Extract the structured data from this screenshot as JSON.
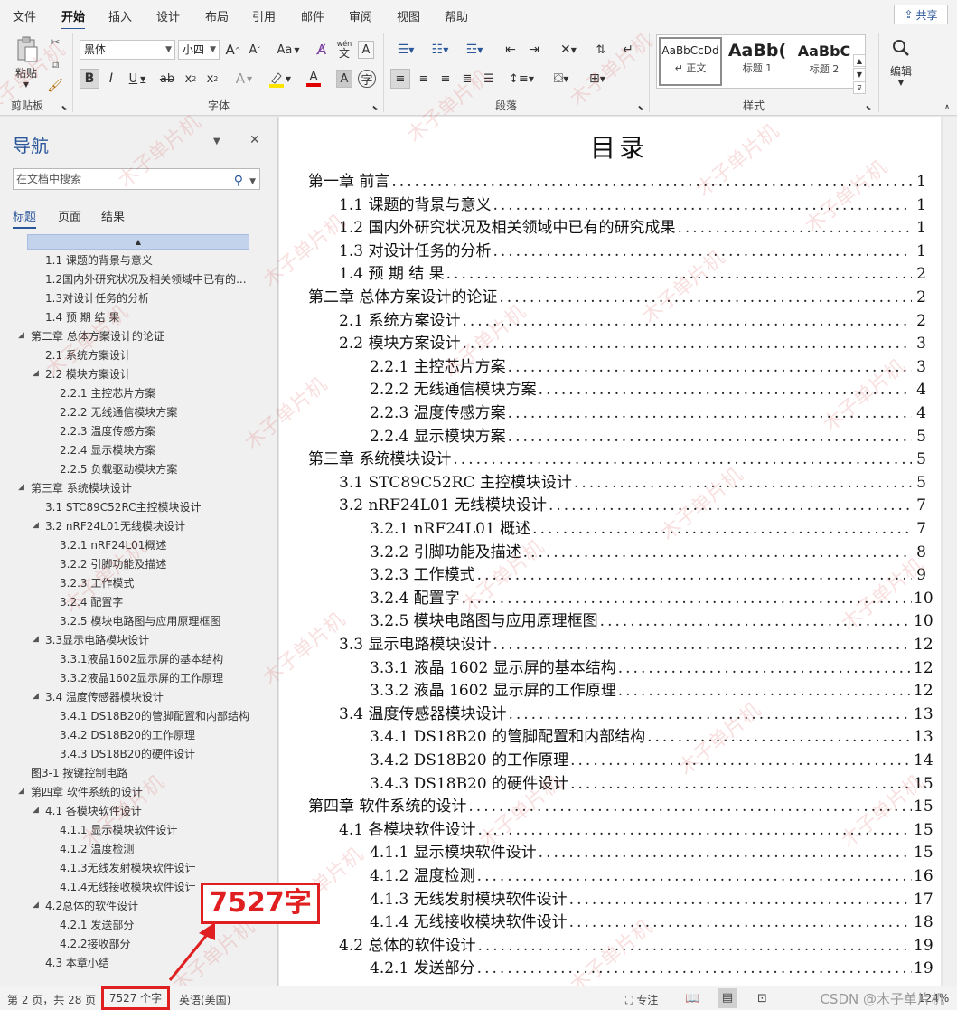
{
  "menu": [
    "文件",
    "开始",
    "插入",
    "设计",
    "布局",
    "引用",
    "邮件",
    "审阅",
    "视图",
    "帮助"
  ],
  "share": "共享",
  "ribbon": {
    "paste": "粘贴",
    "clipboard": "剪贴板",
    "font_name": "黑体",
    "font_size": "小四",
    "font_group": "字体",
    "paragraph_group": "段落",
    "styles_group": "样式",
    "edit": "编辑",
    "styles": [
      {
        "sample": "AaBbCcDd",
        "name": "↵ 正文"
      },
      {
        "sample": "AaBb(",
        "name": "标题 1"
      },
      {
        "sample": "AaBbC",
        "name": "标题 2"
      }
    ],
    "wen": "wén",
    "wen_char": "文",
    "A_box": "A",
    "Aa": "Aa"
  },
  "nav": {
    "title": "导航",
    "search_placeholder": "在文档中搜索",
    "tabs": [
      "标题",
      "页面",
      "结果"
    ],
    "items": [
      {
        "text": "1.1 课题的背景与意义",
        "level": 2,
        "tri": false
      },
      {
        "text": "1.2国内外研究状况及相关领域中已有的...",
        "level": 2,
        "tri": false
      },
      {
        "text": "1.3对设计任务的分析",
        "level": 2,
        "tri": false
      },
      {
        "text": "1.4 预 期 结 果",
        "level": 2,
        "tri": false
      },
      {
        "text": "第二章 总体方案设计的论证",
        "level": 1,
        "tri": true
      },
      {
        "text": "2.1 系统方案设计",
        "level": 2,
        "tri": false
      },
      {
        "text": "2.2 模块方案设计",
        "level": 2,
        "tri": true
      },
      {
        "text": "2.2.1 主控芯片方案",
        "level": 3,
        "tri": false
      },
      {
        "text": "2.2.2 无线通信模块方案",
        "level": 3,
        "tri": false
      },
      {
        "text": "2.2.3 温度传感方案",
        "level": 3,
        "tri": false
      },
      {
        "text": "2.2.4 显示模块方案",
        "level": 3,
        "tri": false
      },
      {
        "text": "2.2.5 负载驱动模块方案",
        "level": 3,
        "tri": false
      },
      {
        "text": "第三章 系统模块设计",
        "level": 1,
        "tri": true
      },
      {
        "text": "3.1 STC89C52RC主控模块设计",
        "level": 2,
        "tri": false
      },
      {
        "text": "3.2 nRF24L01无线模块设计",
        "level": 2,
        "tri": true
      },
      {
        "text": "3.2.1 nRF24L01概述",
        "level": 3,
        "tri": false
      },
      {
        "text": "3.2.2 引脚功能及描述",
        "level": 3,
        "tri": false
      },
      {
        "text": "3.2.3 工作模式",
        "level": 3,
        "tri": false
      },
      {
        "text": "3.2.4 配置字",
        "level": 3,
        "tri": false
      },
      {
        "text": "3.2.5 模块电路图与应用原理框图",
        "level": 3,
        "tri": false
      },
      {
        "text": "3.3显示电路模块设计",
        "level": 2,
        "tri": true
      },
      {
        "text": "3.3.1液晶1602显示屏的基本结构",
        "level": 3,
        "tri": false
      },
      {
        "text": "3.3.2液晶1602显示屏的工作原理",
        "level": 3,
        "tri": false
      },
      {
        "text": "3.4 温度传感器模块设计",
        "level": 2,
        "tri": true
      },
      {
        "text": "3.4.1 DS18B20的管脚配置和内部结构",
        "level": 3,
        "tri": false
      },
      {
        "text": "3.4.2 DS18B20的工作原理",
        "level": 3,
        "tri": false
      },
      {
        "text": "3.4.3 DS18B20的硬件设计",
        "level": 3,
        "tri": false
      },
      {
        "text": "图3-1 按键控制电路",
        "level": 1,
        "tri": false
      },
      {
        "text": "第四章 软件系统的设计",
        "level": 1,
        "tri": true
      },
      {
        "text": "4.1 各模块软件设计",
        "level": 2,
        "tri": true
      },
      {
        "text": "4.1.1 显示模块软件设计",
        "level": 3,
        "tri": false
      },
      {
        "text": "4.1.2 温度检测",
        "level": 3,
        "tri": false
      },
      {
        "text": "4.1.3无线发射模块软件设计",
        "level": 3,
        "tri": false
      },
      {
        "text": "4.1.4无线接收模块软件设计",
        "level": 3,
        "tri": false
      },
      {
        "text": "4.2总体的软件设计",
        "level": 2,
        "tri": true
      },
      {
        "text": "4.2.1 发送部分",
        "level": 3,
        "tri": false
      },
      {
        "text": "4.2.2接收部分",
        "level": 3,
        "tri": false
      },
      {
        "text": "4.3 本章小结",
        "level": 2,
        "tri": false
      }
    ]
  },
  "doc": {
    "title": "目录",
    "toc": [
      {
        "text": "第一章  前言",
        "page": "1",
        "level": 1
      },
      {
        "text": "1.1  课题的背景与意义",
        "page": "1",
        "level": 2
      },
      {
        "text": "1.2 国内外研究状况及相关领域中已有的研究成果",
        "page": "1",
        "level": 2
      },
      {
        "text": "1.3 对设计任务的分析",
        "page": "1",
        "level": 2
      },
      {
        "text": "1.4  预  期  结  果",
        "page": "2",
        "level": 2
      },
      {
        "text": "第二章  总体方案设计的论证",
        "page": "2",
        "level": 1
      },
      {
        "text": "2.1  系统方案设计",
        "page": "2",
        "level": 2
      },
      {
        "text": "2.2  模块方案设计",
        "page": "3",
        "level": 2
      },
      {
        "text": "2.2.1  主控芯片方案",
        "page": "3",
        "level": 3
      },
      {
        "text": "2.2.2  无线通信模块方案",
        "page": "4",
        "level": 3
      },
      {
        "text": "2.2.3  温度传感方案",
        "page": "4",
        "level": 3
      },
      {
        "text": "2.2.4  显示模块方案",
        "page": "5",
        "level": 3
      },
      {
        "text": "第三章  系统模块设计",
        "page": "5",
        "level": 1
      },
      {
        "text": "3.1  STC89C52RC 主控模块设计",
        "page": "5",
        "level": 2
      },
      {
        "text": "3.2   nRF24L01 无线模块设计",
        "page": "7",
        "level": 2
      },
      {
        "text": "3.2.1   nRF24L01 概述",
        "page": "7",
        "level": 3
      },
      {
        "text": "3.2.2   引脚功能及描述",
        "page": "8",
        "level": 3
      },
      {
        "text": "3.2.3  工作模式",
        "page": "9",
        "level": 3
      },
      {
        "text": "3.2.4  配置字",
        "page": "10",
        "level": 3
      },
      {
        "text": "3.2.5  模块电路图与应用原理框图",
        "page": "10",
        "level": 3
      },
      {
        "text": "3.3 显示电路模块设计",
        "page": "12",
        "level": 2
      },
      {
        "text": "3.3.1 液晶 1602 显示屏的基本结构",
        "page": "12",
        "level": 3
      },
      {
        "text": "3.3.2 液晶 1602 显示屏的工作原理",
        "page": "12",
        "level": 3
      },
      {
        "text": "3.4  温度传感器模块设计",
        "page": "13",
        "level": 2
      },
      {
        "text": "3.4.1 DS18B20 的管脚配置和内部结构",
        "page": "13",
        "level": 3
      },
      {
        "text": "3.4.2 DS18B20 的工作原理",
        "page": "14",
        "level": 3
      },
      {
        "text": "3.4.3 DS18B20 的硬件设计",
        "page": "15",
        "level": 3
      },
      {
        "text": "第四章  软件系统的设计",
        "page": "15",
        "level": 1
      },
      {
        "text": "4.1   各模块软件设计",
        "page": "15",
        "level": 2
      },
      {
        "text": "4.1.1  显示模块软件设计",
        "page": "15",
        "level": 3
      },
      {
        "text": "4.1.2  温度检测",
        "page": "16",
        "level": 3
      },
      {
        "text": "4.1.3 无线发射模块软件设计",
        "page": "17",
        "level": 3
      },
      {
        "text": "4.1.4 无线接收模块软件设计",
        "page": "18",
        "level": 3
      },
      {
        "text": "4.2 总体的软件设计",
        "page": "19",
        "level": 2
      },
      {
        "text": "4.2.1  发送部分",
        "page": "19",
        "level": 3
      }
    ]
  },
  "annotation": "7527字",
  "watermark": "木子单片机",
  "status": {
    "page": "第 2 页，共 28 页",
    "words": "7527 个字",
    "lang": "英语(美国)",
    "focus": "专注",
    "zoom": "124%",
    "csdn": "CSDN @木子单片机"
  }
}
